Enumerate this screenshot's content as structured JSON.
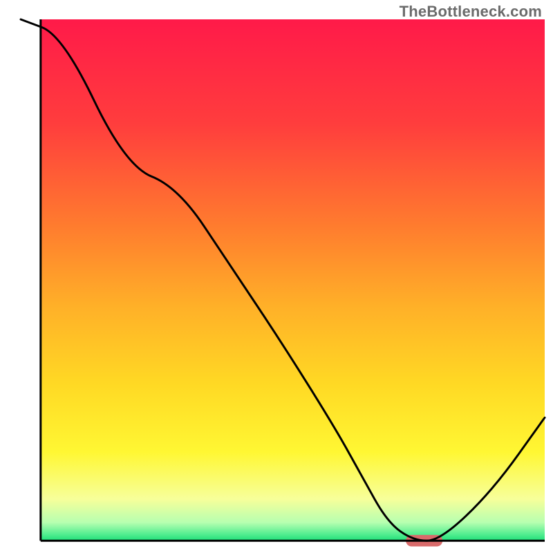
{
  "watermark": "TheBottleneck.com",
  "chart_data": {
    "type": "line",
    "title": "",
    "xlabel": "",
    "ylabel": "",
    "xlim": [
      0,
      100
    ],
    "ylim": [
      0,
      100
    ],
    "x": [
      0,
      8,
      20,
      30,
      40,
      50,
      60,
      65,
      70,
      75,
      80,
      90,
      100
    ],
    "values": [
      100,
      97,
      72,
      68,
      53,
      38,
      22,
      13,
      4,
      0.5,
      0.5,
      10,
      24
    ],
    "gradient_stops": [
      {
        "offset": 0.0,
        "color": "#ff1a49"
      },
      {
        "offset": 0.2,
        "color": "#ff3d3d"
      },
      {
        "offset": 0.4,
        "color": "#ff7d2e"
      },
      {
        "offset": 0.55,
        "color": "#ffb028"
      },
      {
        "offset": 0.7,
        "color": "#ffd924"
      },
      {
        "offset": 0.83,
        "color": "#fff733"
      },
      {
        "offset": 0.92,
        "color": "#f7ff9a"
      },
      {
        "offset": 0.965,
        "color": "#b7ffb0"
      },
      {
        "offset": 0.985,
        "color": "#5ef094"
      },
      {
        "offset": 1.0,
        "color": "#1fe079"
      }
    ],
    "marker": {
      "x_center": 77,
      "y_center": 0.5,
      "width": 7,
      "height": 2.2,
      "color": "#d96b6b"
    },
    "axes": {
      "left_x": 3.8,
      "bottom_y": 0.5,
      "color": "#000000",
      "width": 3
    }
  }
}
